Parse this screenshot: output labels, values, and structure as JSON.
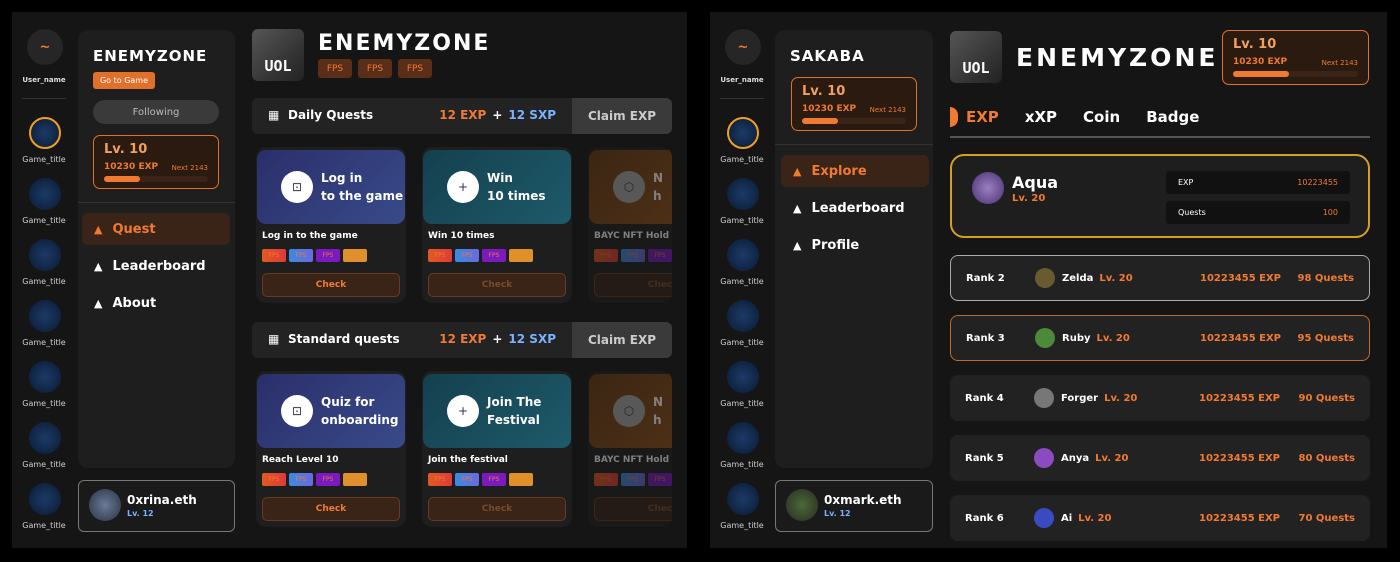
{
  "left": {
    "rail": {
      "user_name": "User_name",
      "games": [
        "Game_title",
        "Game_title",
        "Game_title",
        "Game_title",
        "Game_title",
        "Game_title",
        "Game_title"
      ],
      "game_logo": "GameSkulls"
    },
    "sidebar": {
      "title": "ENEMYZONE",
      "go_button": "Go to Game",
      "following": "Following",
      "level": {
        "lv": "Lv. 10",
        "exp": "10230 EXP",
        "next": "Next 2143",
        "progress": 0.35
      },
      "nav": [
        {
          "label": "Quest",
          "active": true
        },
        {
          "label": "Leaderboard"
        },
        {
          "label": "About"
        }
      ],
      "user": {
        "name": "0xrina.eth",
        "lv": "Lv. 12"
      }
    },
    "main": {
      "logo": "UOL",
      "title": "ENEMYZONE",
      "tags": [
        "FPS",
        "FPS",
        "FPS"
      ],
      "sections": [
        {
          "title": "Daily Quests",
          "exp": "12 EXP",
          "plus": "+",
          "sxp": "12 SXP",
          "claim": "Claim EXP",
          "cards": [
            {
              "banner": "Log in\nto the game",
              "name": "Log in to the game",
              "check": "Check"
            },
            {
              "banner": "Win\n10 times",
              "name": "Win 10 times",
              "check": "Check"
            },
            {
              "banner": "N\nh",
              "name": "BAYC NFT Hold",
              "check": "Check"
            }
          ]
        },
        {
          "title": "Standard quests",
          "exp": "12 EXP",
          "plus": "+",
          "sxp": "12 SXP",
          "claim": "Claim EXP",
          "cards": [
            {
              "banner": "Quiz for\nonboarding",
              "name": "Reach Level 10",
              "check": "Check"
            },
            {
              "banner": "Join The\nFestival",
              "name": "Join the festival",
              "check": "Check"
            },
            {
              "banner": "N\nh",
              "name": "BAYC NFT Hold",
              "check": "Check"
            }
          ]
        }
      ],
      "tag_label": "FPS"
    }
  },
  "right": {
    "rail": {
      "user_name": "User_name",
      "games": [
        "Game_title",
        "Game_title",
        "Game_title",
        "Game_title",
        "Game_title",
        "Game_title",
        "Game_title"
      ]
    },
    "sidebar": {
      "title": "SAKABA",
      "level": {
        "lv": "Lv. 10",
        "exp": "10230 EXP",
        "next": "Next 2143",
        "progress": 0.35
      },
      "nav": [
        {
          "label": "Explore",
          "active": true
        },
        {
          "label": "Leaderboard"
        },
        {
          "label": "Profile"
        }
      ],
      "user": {
        "name": "0xmark.eth",
        "lv": "Lv. 12"
      }
    },
    "main": {
      "logo": "UOL",
      "title": "ENEMYZONE",
      "level": {
        "lv": "Lv. 10",
        "exp": "10230 EXP",
        "next": "Next 2143",
        "progress": 0.45
      },
      "tabs": [
        "EXP",
        "xXP",
        "Coin",
        "Badge"
      ],
      "top": {
        "name": "Aqua",
        "lv": "Lv. 20",
        "exp_label": "EXP",
        "exp": "10223455",
        "quests_label": "Quests",
        "quests": "100"
      },
      "ranks": [
        {
          "rank": "Rank 2",
          "name": "Zelda",
          "lv": "Lv. 20",
          "exp": "10223455 EXP",
          "quests": "98 Quests"
        },
        {
          "rank": "Rank 3",
          "name": "Ruby",
          "lv": "Lv. 20",
          "exp": "10223455 EXP",
          "quests": "95 Quests"
        },
        {
          "rank": "Rank 4",
          "name": "Forger",
          "lv": "Lv. 20",
          "exp": "10223455 EXP",
          "quests": "90 Quests"
        },
        {
          "rank": "Rank 5",
          "name": "Anya",
          "lv": "Lv. 20",
          "exp": "10223455 EXP",
          "quests": "80 Quests"
        },
        {
          "rank": "Rank 6",
          "name": "Ai",
          "lv": "Lv. 20",
          "exp": "10223455 EXP",
          "quests": "70 Quests"
        }
      ]
    }
  },
  "colors": {
    "accent": "#f07a32",
    "gold": "#d4a020",
    "sxp": "#7ab0ff"
  }
}
